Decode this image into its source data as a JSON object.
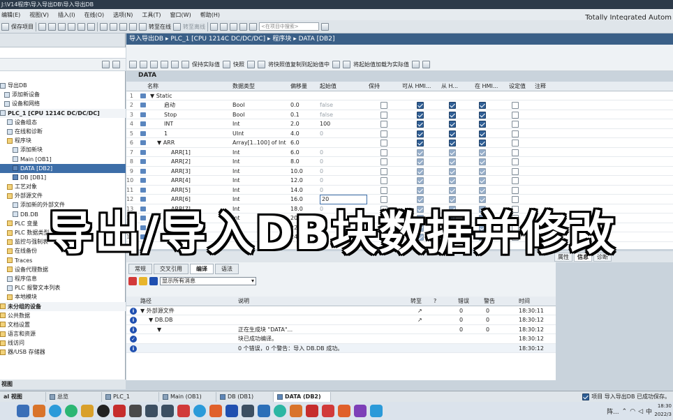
{
  "titlebar": {
    "title": " J:\\V14程序\\导入导出DB\\导入导出DB"
  },
  "menu": [
    "编辑(E)",
    "视图(V)",
    "插入(I)",
    "在线(O)",
    "选项(N)",
    "工具(T)",
    "窗口(W)",
    "帮助(H)"
  ],
  "brand": "Totally Integrated Autom",
  "toolbar": {
    "save_project": "保存项目",
    "go_online": "转至在线",
    "go_offline": "转至离线",
    "search_placeholder": "<在项目中搜索>"
  },
  "breadcrumb": "导入导出DB ▸ PLC_1 [CPU 1214C DC/DC/DC] ▸ 程序块 ▸ DATA [DB2]",
  "editor_toolbar": {
    "keep_actual": "保持实际值",
    "snapshot": "快照",
    "copy_snapshot": "将快照值复制到起始值中",
    "load_start": "将起始值加载为实际值"
  },
  "block_title": "DATA",
  "tree": [
    {
      "label": "导出DB",
      "icon": "project-icon",
      "style": ""
    },
    {
      "label": "添加新设备",
      "icon": "add-device-icon",
      "style": ""
    },
    {
      "label": "设备和网络",
      "icon": "network-icon",
      "style": ""
    },
    {
      "label": "PLC_1 [CPU 1214C DC/DC/DC]",
      "icon": "plc-icon",
      "style": "bold alt"
    },
    {
      "label": "设备组态",
      "icon": "device-config-icon",
      "style": ""
    },
    {
      "label": "在线和诊断",
      "icon": "diagnostics-icon",
      "style": ""
    },
    {
      "label": "程序块",
      "icon": "folder-icon",
      "style": ""
    },
    {
      "label": "添加新块",
      "icon": "add-block-icon",
      "style": ""
    },
    {
      "label": "Main [OB1]",
      "icon": "ob-icon",
      "style": ""
    },
    {
      "label": "DATA [DB2]",
      "icon": "db-icon",
      "style": "sel"
    },
    {
      "label": "DB [DB1]",
      "icon": "db-icon",
      "style": ""
    },
    {
      "label": "工艺对象",
      "icon": "folder-icon",
      "style": ""
    },
    {
      "label": "外部源文件",
      "icon": "folder-icon",
      "style": ""
    },
    {
      "label": "添加新的外部文件",
      "icon": "add-file-icon",
      "style": ""
    },
    {
      "label": "DB.DB",
      "icon": "file-icon",
      "style": ""
    },
    {
      "label": "PLC 变量",
      "icon": "folder-icon",
      "style": ""
    },
    {
      "label": "PLC 数据类型",
      "icon": "folder-icon",
      "style": ""
    },
    {
      "label": "监控与强制表",
      "icon": "folder-icon",
      "style": ""
    },
    {
      "label": "在线备份",
      "icon": "folder-icon",
      "style": ""
    },
    {
      "label": "Traces",
      "icon": "folder-icon",
      "style": ""
    },
    {
      "label": "设备代理数据",
      "icon": "folder-icon",
      "style": ""
    },
    {
      "label": "程序信息",
      "icon": "info-icon",
      "style": ""
    },
    {
      "label": "PLC 报警文本列表",
      "icon": "alarm-icon",
      "style": ""
    },
    {
      "label": "本地模块",
      "icon": "folder-icon",
      "style": ""
    },
    {
      "label": "未分组的设备",
      "icon": "folder-icon",
      "style": "bold alt"
    },
    {
      "label": "公共数据",
      "icon": "folder-icon",
      "style": ""
    },
    {
      "label": "文档设置",
      "icon": "folder-icon",
      "style": ""
    },
    {
      "label": "语言和资源",
      "icon": "folder-icon",
      "style": ""
    },
    {
      "label": "线访问",
      "icon": "folder-icon",
      "style": ""
    },
    {
      "label": "器/USB 存储器",
      "icon": "folder-icon",
      "style": ""
    }
  ],
  "leftpane_bottom": "视图",
  "grid": {
    "headers": [
      "名称",
      "数据类型",
      "偏移量",
      "起始值",
      "保持",
      "可从 HMI...",
      "从 H...",
      "在 HMI...",
      "设定值",
      "注释"
    ],
    "rows": [
      {
        "n": "1",
        "name": "▼ Static",
        "type": "",
        "offset": "",
        "start": "",
        "mute": false,
        "indent": 0,
        "cb": []
      },
      {
        "n": "2",
        "name": "启动",
        "type": "Bool",
        "offset": "0.0",
        "start": "false",
        "mute": true,
        "indent": 2,
        "cb": [
          0,
          1,
          1,
          1,
          0
        ]
      },
      {
        "n": "3",
        "name": "Stop",
        "type": "Bool",
        "offset": "0.1",
        "start": "false",
        "mute": true,
        "indent": 2,
        "cb": [
          0,
          1,
          1,
          1,
          0
        ]
      },
      {
        "n": "4",
        "name": "INT",
        "type": "Int",
        "offset": "2.0",
        "start": "100",
        "mute": false,
        "indent": 2,
        "cb": [
          0,
          1,
          1,
          1,
          0
        ]
      },
      {
        "n": "5",
        "name": "1",
        "type": "UInt",
        "offset": "4.0",
        "start": "0",
        "mute": true,
        "indent": 2,
        "cb": [
          0,
          1,
          1,
          1,
          0
        ]
      },
      {
        "n": "6",
        "name": "▼ ARR",
        "type": "Array[1..100] of Int",
        "offset": "6.0",
        "start": "",
        "mute": false,
        "indent": 1,
        "cb": [
          0,
          1,
          1,
          1,
          0
        ]
      },
      {
        "n": "7",
        "name": "ARR[1]",
        "type": "Int",
        "offset": "6.0",
        "start": "0",
        "mute": true,
        "indent": 3,
        "cb": [
          0,
          2,
          2,
          2,
          0
        ]
      },
      {
        "n": "8",
        "name": "ARR[2]",
        "type": "Int",
        "offset": "8.0",
        "start": "0",
        "mute": true,
        "indent": 3,
        "cb": [
          0,
          2,
          2,
          2,
          0
        ]
      },
      {
        "n": "9",
        "name": "ARR[3]",
        "type": "Int",
        "offset": "10.0",
        "start": "0",
        "mute": true,
        "indent": 3,
        "cb": [
          0,
          2,
          2,
          2,
          0
        ]
      },
      {
        "n": "10",
        "name": "ARR[4]",
        "type": "Int",
        "offset": "12.0",
        "start": "0",
        "mute": true,
        "indent": 3,
        "cb": [
          0,
          2,
          2,
          2,
          0
        ]
      },
      {
        "n": "11",
        "name": "ARR[5]",
        "type": "Int",
        "offset": "14.0",
        "start": "0",
        "mute": true,
        "indent": 3,
        "cb": [
          0,
          2,
          2,
          2,
          0
        ]
      },
      {
        "n": "12",
        "name": "ARR[6]",
        "type": "Int",
        "offset": "16.0",
        "start": "20",
        "mute": false,
        "indent": 3,
        "cb": [
          0,
          2,
          2,
          2,
          0
        ],
        "editing": true
      },
      {
        "n": "13",
        "name": "ARR[7]",
        "type": "Int",
        "offset": "18.0",
        "start": "0",
        "mute": true,
        "indent": 3,
        "cb": [
          0,
          2,
          2,
          2,
          0
        ]
      },
      {
        "n": "14",
        "name": "ARR[8]",
        "type": "Int",
        "offset": "20.0",
        "start": "0",
        "mute": true,
        "indent": 3,
        "cb": [
          0,
          2,
          2,
          2,
          0
        ]
      },
      {
        "n": "15",
        "name": "ARR[9]",
        "type": "Int",
        "offset": "22.0",
        "start": "0",
        "mute": true,
        "indent": 3,
        "cb": [
          0,
          2,
          2,
          2,
          0
        ]
      },
      {
        "n": "16",
        "name": "ARR[10]",
        "type": "Int",
        "offset": "24.0",
        "start": "0",
        "mute": true,
        "indent": 3,
        "cb": [
          0,
          2,
          2,
          2,
          0
        ]
      }
    ]
  },
  "banner": "导出/导入DB块数据并修改",
  "inspector_tabs": [
    "属性",
    "信息",
    "诊断"
  ],
  "subtabs": [
    "常规",
    "交叉引用",
    "编译",
    "语法"
  ],
  "filter": "显示所有消息",
  "messages": {
    "headers": [
      "路径",
      "说明",
      "转至",
      "?",
      "错误",
      "警告",
      "时间"
    ],
    "rows": [
      {
        "path": "▼ 外部源文件",
        "desc": "",
        "goto": "↗",
        "err": "0",
        "warn": "0",
        "time": "18:30:11",
        "indent": 1,
        "icon": "i"
      },
      {
        "path": "▼ DB.DB",
        "desc": "",
        "goto": "↗",
        "err": "0",
        "warn": "0",
        "time": "18:30:12",
        "indent": 2,
        "icon": "i"
      },
      {
        "path": "▼",
        "desc": "正在生成块 \"DATA\"...",
        "goto": "",
        "err": "0",
        "warn": "0",
        "time": "18:30:12",
        "indent": 3,
        "icon": "i"
      },
      {
        "path": "",
        "desc": "块已成功编译。",
        "goto": "",
        "err": "",
        "warn": "",
        "time": "18:30:12",
        "indent": 3,
        "icon": "ok"
      },
      {
        "path": "",
        "desc": "0 个错误，0 个警告：导入 DB.DB 成功。",
        "goto": "",
        "err": "",
        "warn": "",
        "time": "18:30:12",
        "indent": 3,
        "icon": "i"
      }
    ]
  },
  "portal": {
    "view": "al 视图",
    "tabs": [
      "总览",
      "PLC_1",
      "Main (OB1)",
      "DB (DB1)",
      "DATA (DB2)"
    ],
    "status": "项目 导入导出DB 已成功保存。"
  },
  "taskbar": {
    "time": "18:30",
    "date": "2022/3",
    "tray_text": "阵..."
  }
}
